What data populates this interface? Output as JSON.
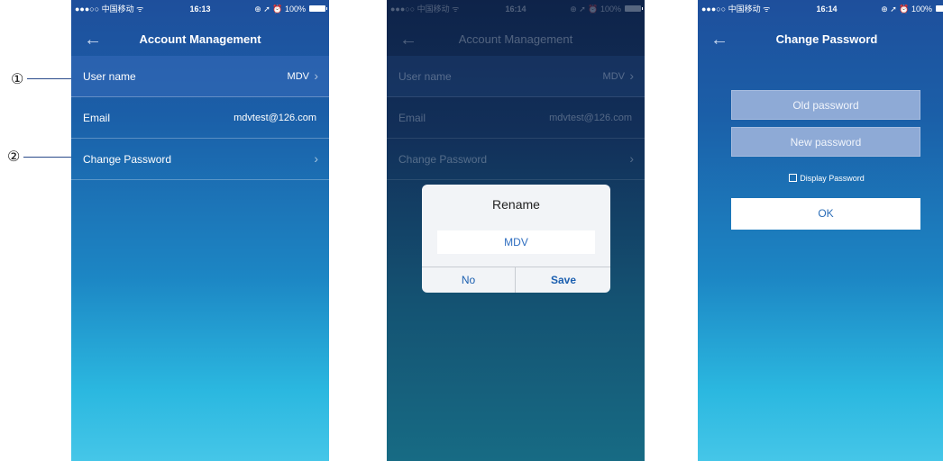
{
  "status_bars": [
    {
      "carrier": "●●●○○ 中国移动 ᯤ",
      "time": "16:13",
      "right": "⊕ ➚ ⏰ 100%"
    },
    {
      "carrier": "●●●○○ 中国移动 ᯤ",
      "time": "16:14",
      "right": "⊕ ➚ ⏰ 100%"
    },
    {
      "carrier": "●●●○○ 中国移动 ᯤ",
      "time": "16:14",
      "right": "⊕ ➚ ⏰ 100%"
    }
  ],
  "back_glyph": "←",
  "arrow_glyph": "›",
  "account_screen": {
    "title": "Account Management",
    "rows": [
      {
        "label": "User name",
        "value": "MDV"
      },
      {
        "label": "Email",
        "value": "mdvtest@126.com"
      },
      {
        "label": "Change Password",
        "value": ""
      }
    ]
  },
  "rename_dialog": {
    "title": "Rename",
    "input_value": "MDV",
    "no_label": "No",
    "save_label": "Save"
  },
  "change_password_screen": {
    "title": "Change Password",
    "old_placeholder": "Old password",
    "new_placeholder": "New password",
    "display_password_label": "Display Password",
    "ok_label": "OK"
  },
  "callouts": [
    "①",
    "②"
  ],
  "colors": {
    "header_blue": "#1e4f9c",
    "bottom_cyan": "#45c6e8",
    "dialog_accent": "#1b5fb0"
  },
  "icons": [
    "back-arrow-icon",
    "chevron-right-icon",
    "battery-icon",
    "wifi-icon",
    "checkbox-icon"
  ]
}
